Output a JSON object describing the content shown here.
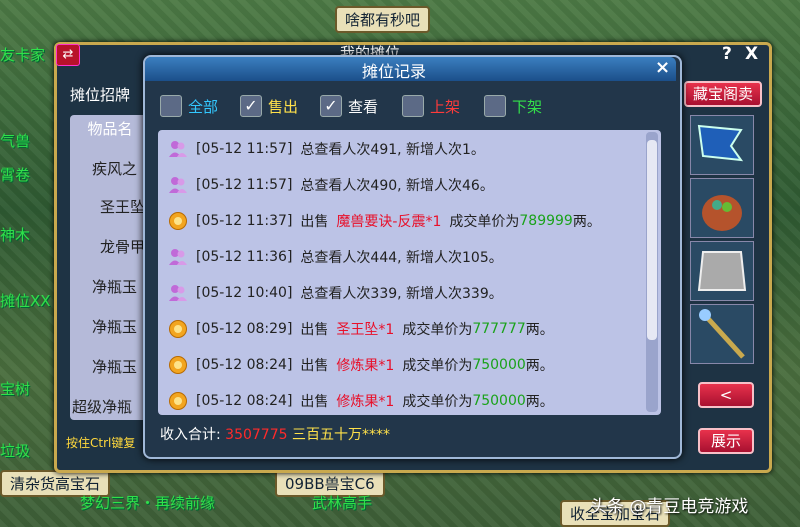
{
  "scene": {
    "signs": [
      "啥都有秒吧",
      "清杂货高宝石",
      "09BB兽宝C6",
      "收全宝加宝石"
    ],
    "left_tags": [
      "友卡家",
      "气兽",
      "霄卷",
      "神木",
      "摊位XX",
      "宝树",
      "垃圾"
    ],
    "overlay_texts": [
      "梦幻三界・再续前缘",
      "武林高手"
    ]
  },
  "back_panel": {
    "title": "我的摊位",
    "help": "?",
    "close": "X",
    "toggle_icon": "⇄",
    "stall_sign_label": "摊位招牌",
    "items_header": "物品名",
    "items": [
      "疾风之",
      "圣王坠",
      "龙骨甲",
      "净瓶玉",
      "净瓶玉",
      "净瓶玉",
      "超级净瓶"
    ],
    "ctrl_hint": "按住Ctrl键复",
    "treasure_btn": "藏宝阁卖",
    "prev_btn": "<",
    "show_btn": "展示"
  },
  "record_panel": {
    "title": "摊位记录",
    "close": "×",
    "filters": [
      {
        "label": "全部",
        "checked": false,
        "color": "#33c8ff"
      },
      {
        "label": "售出",
        "checked": true,
        "color": "#ffe14a"
      },
      {
        "label": "查看",
        "checked": true,
        "color": "#ffffff"
      },
      {
        "label": "上架",
        "checked": false,
        "color": "#ff3b3b"
      },
      {
        "label": "下架",
        "checked": false,
        "color": "#33e04a"
      }
    ],
    "entries": [
      {
        "type": "view",
        "time": "[05-12 11:57]",
        "text": "总查看人次491, 新增人次1。"
      },
      {
        "type": "view",
        "time": "[05-12 11:57]",
        "text": "总查看人次490, 新增人次46。"
      },
      {
        "type": "sale",
        "time": "[05-12 11:37]",
        "prefix": "出售",
        "item": "魔兽要诀-反震*1",
        "mid": "成交单价为",
        "price": "789999",
        "suffix": "两。"
      },
      {
        "type": "view",
        "time": "[05-12 11:36]",
        "text": "总查看人次444, 新增人次105。"
      },
      {
        "type": "view",
        "time": "[05-12 10:40]",
        "text": "总查看人次339, 新增人次339。"
      },
      {
        "type": "sale",
        "time": "[05-12 08:29]",
        "prefix": "出售",
        "item": "圣王坠*1",
        "mid": "成交单价为",
        "price": "777777",
        "suffix": "两。"
      },
      {
        "type": "sale",
        "time": "[05-12 08:24]",
        "prefix": "出售",
        "item": "修炼果*1",
        "mid": "成交单价为",
        "price": "750000",
        "suffix": "两。"
      },
      {
        "type": "sale",
        "time": "[05-12 08:24]",
        "prefix": "出售",
        "item": "修炼果*1",
        "mid": "成交单价为",
        "price": "750000",
        "suffix": "两。"
      }
    ],
    "total_label": "收入合计:",
    "total_value": "3507775",
    "total_words": "三百五十万****"
  },
  "watermark": "头条 @青豆电竞游戏",
  "colors": {
    "item_red": "#e8102a",
    "price_green": "#1aa21a",
    "total_red": "#ff2a2a",
    "total_yellow": "#ffe14a"
  }
}
